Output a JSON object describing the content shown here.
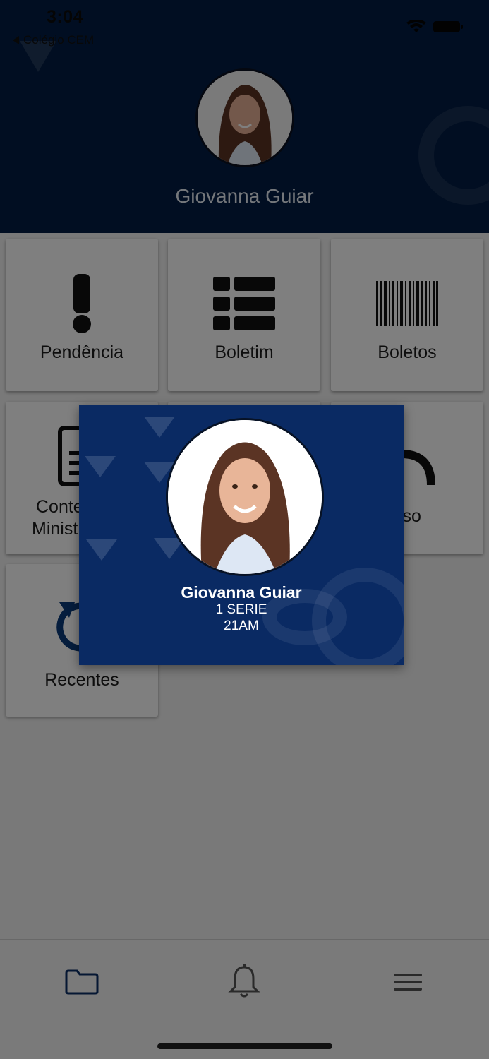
{
  "status_bar": {
    "time": "3:04",
    "back_app": "Colégio CEM"
  },
  "header": {
    "student_name": "Giovanna Guiar"
  },
  "menu": {
    "pendencia": "Pendência",
    "boletim": "Boletim",
    "boletos": "Boletos",
    "conteudo_line1": "Conte",
    "conteudo_line2": "Minist",
    "aviso": "iso",
    "recentes": "Recentes"
  },
  "popup": {
    "name": "Giovanna Guiar",
    "grade": "1 SERIE",
    "class": "21AM"
  },
  "tabbar": {
    "items": [
      "folder-icon",
      "bell-icon",
      "menu-icon"
    ]
  },
  "colors": {
    "header_bg": "#031d44",
    "popup_bg": "#0a2a63",
    "accent": "#0b3b7a"
  }
}
